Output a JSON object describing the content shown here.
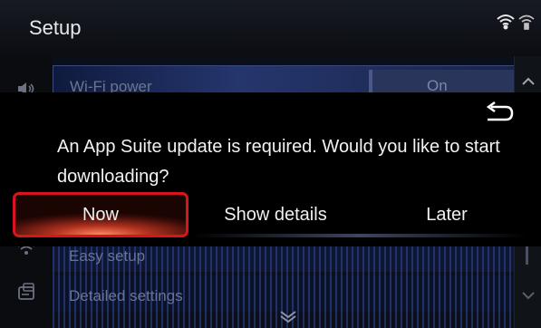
{
  "header": {
    "title": "Setup",
    "icons": [
      "wifi-icon",
      "cellular-signal-icon"
    ]
  },
  "sidebar": {
    "icons": [
      "speaker-icon",
      "wifi-icon",
      "settings-panel-icon"
    ]
  },
  "list": {
    "items": [
      {
        "label": "Wi-Fi power",
        "value": "On"
      },
      {
        "label": "Easy setup"
      },
      {
        "label": "Detailed settings"
      }
    ]
  },
  "dialog": {
    "message": "An App Suite update is required. Would you like to start downloading?",
    "back_icon": "back-arrow-icon",
    "buttons": {
      "now": "Now",
      "details": "Show details",
      "later": "Later"
    }
  },
  "colors": {
    "selection_border": "#d8141c",
    "accent_blue": "#2a355c",
    "background": "#000000"
  }
}
